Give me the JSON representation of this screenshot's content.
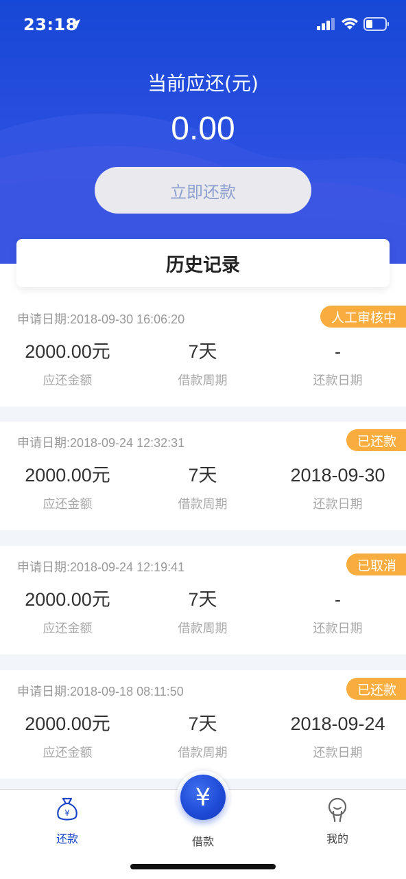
{
  "status_bar": {
    "time": "23:18"
  },
  "header": {
    "due_label": "当前应还(元)",
    "due_amount": "0.00",
    "repay_button": "立即还款"
  },
  "history_title": "历史记录",
  "records": [
    {
      "date": "申请日期:2018-09-30 16:06:20",
      "status": "人工审核中",
      "amount": "2000.00元",
      "amount_label": "应还金额",
      "period": "7天",
      "period_label": "借款周期",
      "repay_date": "-",
      "repay_date_label": "还款日期"
    },
    {
      "date": "申请日期:2018-09-24 12:32:31",
      "status": "已还款",
      "amount": "2000.00元",
      "amount_label": "应还金额",
      "period": "7天",
      "period_label": "借款周期",
      "repay_date": "2018-09-30",
      "repay_date_label": "还款日期"
    },
    {
      "date": "申请日期:2018-09-24 12:19:41",
      "status": "已取消",
      "amount": "2000.00元",
      "amount_label": "应还金额",
      "period": "7天",
      "period_label": "借款周期",
      "repay_date": "-",
      "repay_date_label": "还款日期"
    },
    {
      "date": "申请日期:2018-09-18 08:11:50",
      "status": "已还款",
      "amount": "2000.00元",
      "amount_label": "应还金额",
      "period": "7天",
      "period_label": "借款周期",
      "repay_date": "2018-09-24",
      "repay_date_label": "还款日期"
    }
  ],
  "tab_bar": {
    "repay": "还款",
    "borrow": "借款",
    "mine": "我的",
    "fab_symbol": "¥",
    "repay_icon_symbol": "¥"
  },
  "colors": {
    "header_blue": "#1747d6",
    "status_orange": "#f9ad3e",
    "active_tab": "#1b46c6"
  }
}
